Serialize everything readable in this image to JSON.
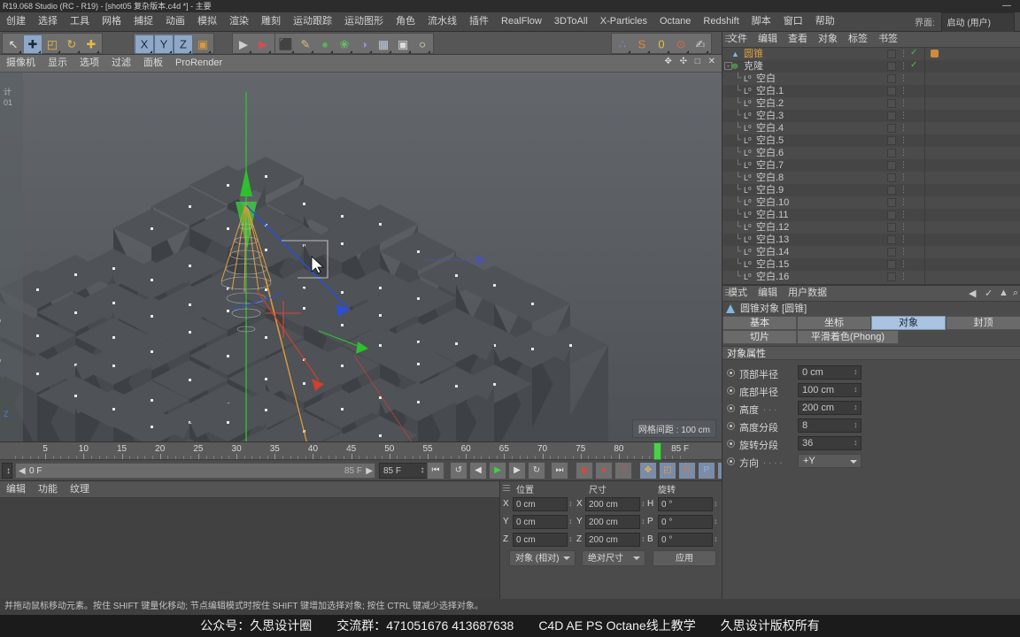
{
  "window": {
    "title": "R19.068 Studio (RC - R19) - [shot05 复杂版本.c4d *] - 主要",
    "minimize_label": "—"
  },
  "layout_selector": {
    "label": "界面:",
    "value": "启动 (用户)"
  },
  "menubar": {
    "items": [
      "创建",
      "选择",
      "工具",
      "网格",
      "捕捉",
      "动画",
      "模拟",
      "渲染",
      "雕刻",
      "运动跟踪",
      "运动图形",
      "角色",
      "流水线",
      "插件",
      "RealFlow",
      "3DToAll",
      "X-Particles",
      "Octane",
      "Redshift",
      "脚本",
      "窗口",
      "帮助"
    ]
  },
  "toolbar": {
    "groups": [
      {
        "name": "select-tools",
        "buttons": [
          {
            "name": "live-selection-tool",
            "glyph": "↖",
            "active": false
          },
          {
            "name": "move-tool",
            "glyph": "✚",
            "active": true
          },
          {
            "name": "scale-tool",
            "glyph": "◰",
            "active": false
          },
          {
            "name": "rotate-tool",
            "glyph": "↻",
            "active": false
          },
          {
            "name": "add-tool",
            "glyph": "✚",
            "active": false
          }
        ]
      },
      {
        "name": "axis-locks",
        "buttons": [
          {
            "name": "x-axis-lock",
            "glyph": "X",
            "active": true
          },
          {
            "name": "y-axis-lock",
            "glyph": "Y",
            "active": true
          },
          {
            "name": "z-axis-lock",
            "glyph": "Z",
            "active": true
          },
          {
            "name": "world-object-coord",
            "glyph": "▣",
            "active": false
          }
        ]
      },
      {
        "name": "render-tools",
        "buttons": [
          {
            "name": "render-view-icon",
            "glyph": "▶",
            "active": false
          },
          {
            "name": "render-region-icon",
            "glyph": "▶",
            "active": false
          },
          {
            "name": "render-settings-icon",
            "glyph": "▶",
            "active": false
          }
        ]
      },
      {
        "name": "primitives",
        "buttons": [
          {
            "name": "cube-primitive-icon",
            "glyph": "⬛",
            "active": false
          },
          {
            "name": "spline-pen-icon",
            "glyph": "✎",
            "active": false
          },
          {
            "name": "generator-icon",
            "glyph": "●",
            "active": false
          },
          {
            "name": "deformer-icon",
            "glyph": "❀",
            "active": false
          },
          {
            "name": "environment-icon",
            "glyph": "◑",
            "active": false
          },
          {
            "name": "floor-icon",
            "glyph": "▦",
            "active": false
          },
          {
            "name": "camera-icon",
            "glyph": "▣",
            "active": false
          },
          {
            "name": "light-icon",
            "glyph": "○",
            "active": false
          }
        ]
      },
      {
        "name": "plugins",
        "buttons": [
          {
            "name": "mograph-cloner-icon",
            "glyph": "∴",
            "active": false
          },
          {
            "name": "sculpt-icon",
            "glyph": "S",
            "active": false
          },
          {
            "name": "psr-icon",
            "glyph": "0",
            "active": false
          },
          {
            "name": "snap-icon",
            "glyph": "⊙",
            "active": false
          },
          {
            "name": "paint-icon",
            "glyph": "✍",
            "active": false
          }
        ]
      }
    ]
  },
  "viewport": {
    "menu": [
      "摄像机",
      "显示",
      "选项",
      "过滤",
      "面板",
      "ProRender"
    ],
    "grid_label": "网格间距 : 100 cm",
    "axis_badge": "Z",
    "left_strip_text": "计\n01",
    "nav_icons": "✥ ✣ □ ✕"
  },
  "timeline": {
    "ticks": [
      5,
      10,
      15,
      20,
      25,
      30,
      35,
      40,
      45,
      50,
      55,
      60,
      65,
      70,
      75,
      80
    ],
    "current_frame": "0 F",
    "end_frame_inline": "85 F",
    "end_frame_field": "85 F",
    "playhead_label": "85 F",
    "transport": [
      {
        "name": "go-to-start-button",
        "glyph": "⏮"
      },
      {
        "name": "previous-key-button",
        "glyph": "↺"
      },
      {
        "name": "step-back-button",
        "glyph": "◀"
      },
      {
        "name": "play-button",
        "glyph": "▶"
      },
      {
        "name": "step-forward-button",
        "glyph": "▶"
      },
      {
        "name": "next-key-button",
        "glyph": "↻"
      },
      {
        "name": "go-to-end-button",
        "glyph": "⏭"
      }
    ],
    "record_tools": [
      {
        "name": "record-active-objects-button",
        "glyph": "◉"
      },
      {
        "name": "autokeying-button",
        "glyph": "●"
      },
      {
        "name": "keyframe-selection-button",
        "glyph": "?"
      }
    ],
    "key_tools": [
      {
        "name": "position-key-icon",
        "glyph": "✥"
      },
      {
        "name": "scale-key-icon",
        "glyph": "◰"
      },
      {
        "name": "rotation-key-icon",
        "glyph": "↻"
      },
      {
        "name": "parameter-key-icon",
        "glyph": "P"
      },
      {
        "name": "point-level-animation-icon",
        "glyph": "∷"
      }
    ],
    "extra_tool": {
      "name": "timeline-layer-icon",
      "glyph": "≣"
    }
  },
  "material_manager": {
    "menu": [
      "编辑",
      "功能",
      "纹理"
    ]
  },
  "coordinates": {
    "headers": [
      "位置",
      "尺寸",
      "旋转"
    ],
    "rows": [
      {
        "pos_axis": "X",
        "pos_value": "0 cm",
        "size_axis": "X",
        "size_value": "200 cm",
        "rot_axis": "H",
        "rot_value": "0 °"
      },
      {
        "pos_axis": "Y",
        "pos_value": "0 cm",
        "size_axis": "Y",
        "size_value": "200 cm",
        "rot_axis": "P",
        "rot_value": "0 °"
      },
      {
        "pos_axis": "Z",
        "pos_value": "0 cm",
        "size_axis": "Z",
        "size_value": "200 cm",
        "rot_axis": "B",
        "rot_value": "0 °"
      }
    ],
    "mode_select": "对象 (相对)",
    "size_select": "绝对尺寸",
    "apply_button": "应用"
  },
  "object_manager": {
    "menu": [
      "文件",
      "编辑",
      "查看",
      "对象",
      "标签",
      "书签"
    ],
    "items": [
      {
        "label": "圆锥",
        "kind": "cone",
        "depth": 0,
        "selected": true,
        "visible_check": true,
        "tag": true
      },
      {
        "label": "克隆",
        "kind": "cloner",
        "depth": 0,
        "selected": false,
        "visible_check": true,
        "tag": false
      },
      {
        "label": "空白",
        "kind": "null",
        "depth": 1,
        "selected": false,
        "visible_check": false,
        "tag": false
      },
      {
        "label": "空白.1",
        "kind": "null",
        "depth": 1,
        "selected": false,
        "visible_check": false,
        "tag": false
      },
      {
        "label": "空白.2",
        "kind": "null",
        "depth": 1,
        "selected": false,
        "visible_check": false,
        "tag": false
      },
      {
        "label": "空白.3",
        "kind": "null",
        "depth": 1,
        "selected": false,
        "visible_check": false,
        "tag": false
      },
      {
        "label": "空白.4",
        "kind": "null",
        "depth": 1,
        "selected": false,
        "visible_check": false,
        "tag": false
      },
      {
        "label": "空白.5",
        "kind": "null",
        "depth": 1,
        "selected": false,
        "visible_check": false,
        "tag": false
      },
      {
        "label": "空白.6",
        "kind": "null",
        "depth": 1,
        "selected": false,
        "visible_check": false,
        "tag": false
      },
      {
        "label": "空白.7",
        "kind": "null",
        "depth": 1,
        "selected": false,
        "visible_check": false,
        "tag": false
      },
      {
        "label": "空白.8",
        "kind": "null",
        "depth": 1,
        "selected": false,
        "visible_check": false,
        "tag": false
      },
      {
        "label": "空白.9",
        "kind": "null",
        "depth": 1,
        "selected": false,
        "visible_check": false,
        "tag": false
      },
      {
        "label": "空白.10",
        "kind": "null",
        "depth": 1,
        "selected": false,
        "visible_check": false,
        "tag": false
      },
      {
        "label": "空白.11",
        "kind": "null",
        "depth": 1,
        "selected": false,
        "visible_check": false,
        "tag": false
      },
      {
        "label": "空白.12",
        "kind": "null",
        "depth": 1,
        "selected": false,
        "visible_check": false,
        "tag": false
      },
      {
        "label": "空白.13",
        "kind": "null",
        "depth": 1,
        "selected": false,
        "visible_check": false,
        "tag": false
      },
      {
        "label": "空白.14",
        "kind": "null",
        "depth": 1,
        "selected": false,
        "visible_check": false,
        "tag": false
      },
      {
        "label": "空白.15",
        "kind": "null",
        "depth": 1,
        "selected": false,
        "visible_check": false,
        "tag": false
      },
      {
        "label": "空白.16",
        "kind": "null",
        "depth": 1,
        "selected": false,
        "visible_check": false,
        "tag": false
      }
    ]
  },
  "attribute_manager": {
    "menu": [
      "模式",
      "编辑",
      "用户数据"
    ],
    "nav": {
      "back": "◀",
      "check": "✓",
      "up": "▲",
      "search": "⌕"
    },
    "object_title": "圆锥对象 [圆锥]",
    "tabs_row1": [
      {
        "label": "基本",
        "selected": false
      },
      {
        "label": "坐标",
        "selected": false
      },
      {
        "label": "对象",
        "selected": true
      },
      {
        "label": "封顶",
        "selected": false
      }
    ],
    "tabs_row2": [
      {
        "label": "切片",
        "selected": false
      },
      {
        "label": "平滑着色(Phong)",
        "selected": false
      }
    ],
    "section_title": "对象属性",
    "properties": [
      {
        "label": "顶部半径",
        "dots": "",
        "value": "0 cm",
        "type": "field"
      },
      {
        "label": "底部半径",
        "dots": "",
        "value": "100 cm",
        "type": "field"
      },
      {
        "label": "高度",
        "dots": ". . .",
        "value": "200 cm",
        "type": "field"
      },
      {
        "label": "高度分段",
        "dots": "",
        "value": "8",
        "type": "field"
      },
      {
        "label": "旋转分段",
        "dots": "",
        "value": "36",
        "type": "field"
      },
      {
        "label": "方向",
        "dots": ". . . .",
        "value": "+Y",
        "type": "dropdown"
      }
    ]
  },
  "status_bar": {
    "text": "并拖动鼠标移动元素。按住 SHIFT 键量化移动; 节点编辑模式时按住 SHIFT 键增加选择对象; 按住 CTRL 键减少选择对象。"
  },
  "banner": {
    "items": [
      "公众号：久思设计圈",
      "交流群：471051676  413687638",
      "C4D AE PS Octane线上教学",
      "久思设计版权所有"
    ]
  },
  "colors": {
    "accent_blue": "#a9c3e0",
    "selection_orange": "#e0a03c",
    "playhead_green": "#4cd04c",
    "panel_bg": "#4b4b4b",
    "viewport_bg": "#5d6166"
  }
}
